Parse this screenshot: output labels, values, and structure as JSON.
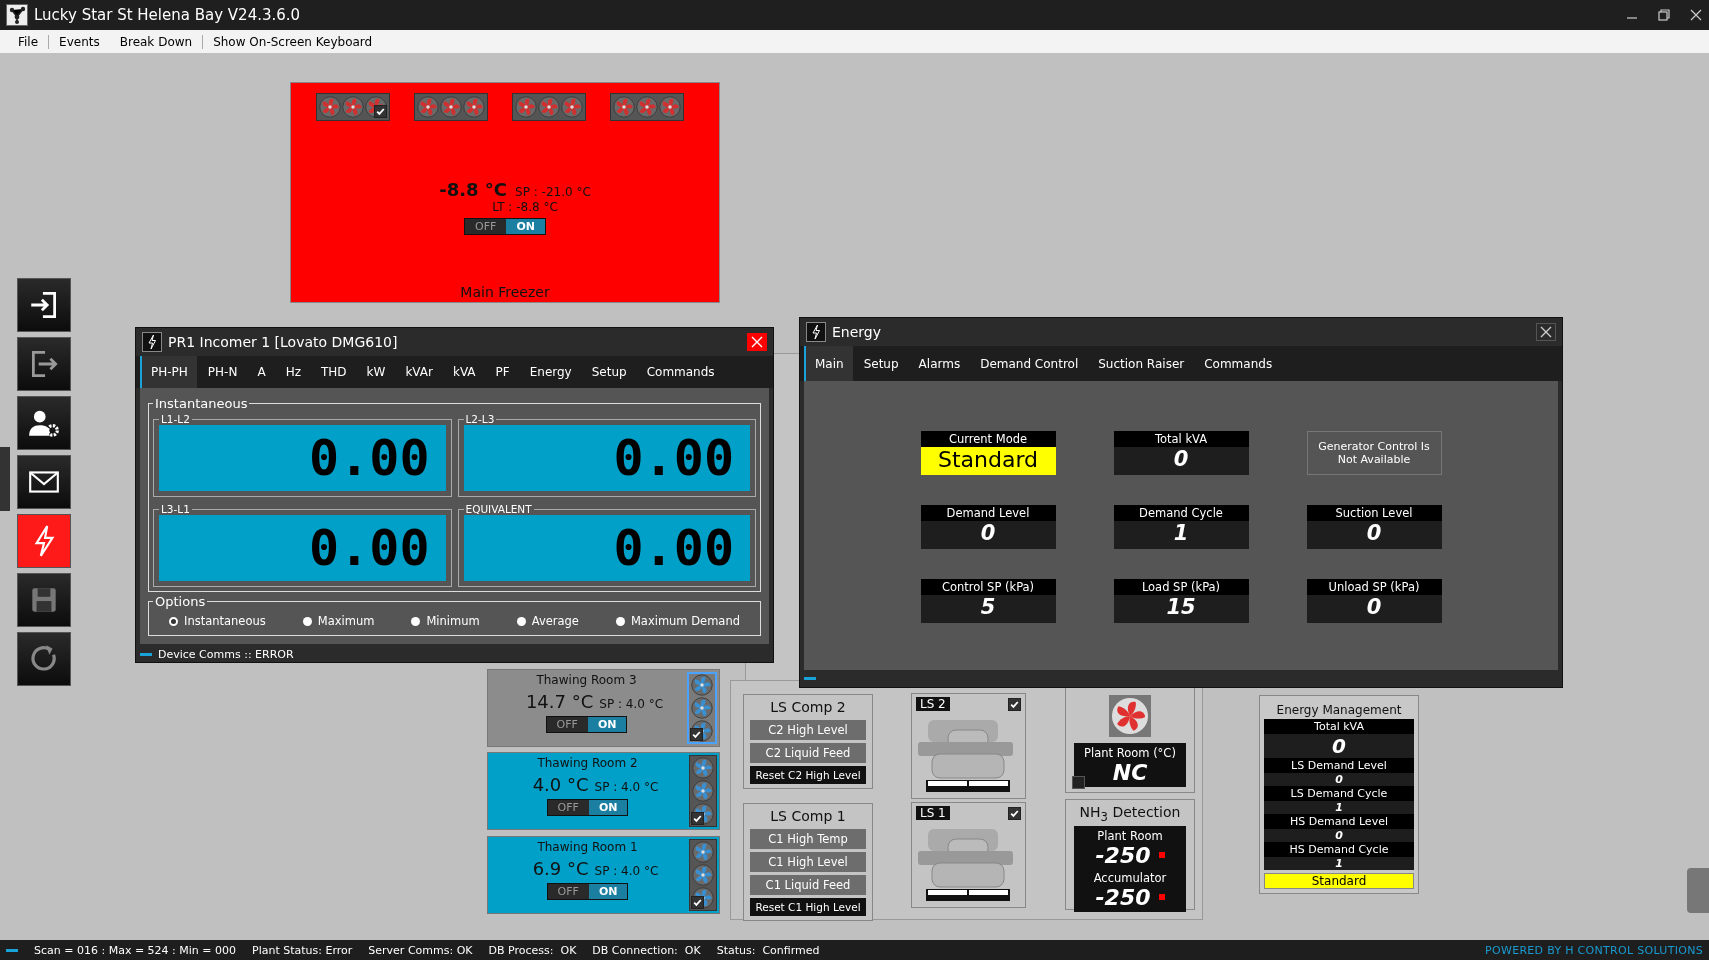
{
  "window": {
    "title": "Lucky Star St Helena Bay V24.3.6.0"
  },
  "menu": [
    {
      "label": "File",
      "separator": true
    },
    {
      "label": "Events",
      "separator": false
    },
    {
      "label": "Break Down",
      "separator": true
    },
    {
      "label": "Show On-Screen Keyboard",
      "separator": false
    }
  ],
  "sidebar": [
    {
      "kind": "login",
      "selected": false
    },
    {
      "kind": "logout",
      "selected": false
    },
    {
      "kind": "users",
      "selected": false
    },
    {
      "kind": "mail",
      "selected": false
    },
    {
      "kind": "energy",
      "selected": true
    },
    {
      "kind": "save",
      "selected": false
    },
    {
      "kind": "refresh",
      "selected": false
    }
  ],
  "rooms": [
    {
      "kind": "freezer",
      "name": "Main Freezer",
      "temp": "-8.8 °C",
      "sp": "SP : -21.0 °C",
      "lt": "LT : -8.8 °C",
      "color": "#ff0000",
      "fan_groups": [
        {
          "checked": true
        },
        {
          "checked": false
        },
        {
          "checked": false
        },
        {
          "checked": false
        }
      ],
      "toggle": [
        {
          "label": "OFF",
          "selected": false
        },
        {
          "label": "ON",
          "selected": true
        }
      ]
    },
    {
      "kind": "thawing",
      "name": "Thawing Room 3",
      "temp": "14.7 °C",
      "sp": "SP : 4.0 °C",
      "color": "#8c8c8c",
      "fans_checked": true,
      "fans_selected": true,
      "toggle": [
        {
          "label": "OFF",
          "selected": false
        },
        {
          "label": "ON",
          "selected": true
        }
      ]
    },
    {
      "kind": "thawing",
      "name": "Thawing Room 2",
      "temp": "4.0 °C",
      "sp": "SP : 4.0 °C",
      "color": "#00a0c8",
      "fans_checked": true,
      "fans_selected": false,
      "toggle": [
        {
          "label": "OFF",
          "selected": false
        },
        {
          "label": "ON",
          "selected": true
        }
      ]
    },
    {
      "kind": "thawing",
      "name": "Thawing Room 1",
      "temp": "6.9 °C",
      "sp": "SP : 4.0 °C",
      "color": "#00a0c8",
      "fans_checked": true,
      "fans_selected": false,
      "toggle": [
        {
          "label": "OFF",
          "selected": false
        },
        {
          "label": "ON",
          "selected": true
        }
      ]
    }
  ],
  "compressor_groups": [
    {
      "title": "LS Comp 2",
      "buttons": [
        {
          "kind": "alarm",
          "label": "C2 High Level"
        },
        {
          "kind": "alarm",
          "label": "C2 Liquid Feed"
        },
        {
          "kind": "reset",
          "label": "Reset C2 High Level"
        }
      ]
    },
    {
      "title": "LS Comp 1",
      "buttons": [
        {
          "kind": "alarm",
          "label": "C1 High Temp"
        },
        {
          "kind": "alarm",
          "label": "C1 High Level"
        },
        {
          "kind": "alarm",
          "label": "C1 Liquid Feed"
        },
        {
          "kind": "reset",
          "label": "Reset C1 High Level"
        }
      ]
    }
  ],
  "compressors": [
    {
      "label": "LS 2",
      "checked": true
    },
    {
      "label": "LS 1",
      "checked": true
    }
  ],
  "extraction_fan": {
    "reading_label": "Plant Room (°C)",
    "reading": "NC",
    "checked": false
  },
  "nh3_detection": {
    "title": "NH$_{3}$ Detection",
    "sensors": [
      {
        "label": "Plant Room",
        "value": "-250"
      },
      {
        "label": "Accumulator",
        "value": "-250"
      }
    ]
  },
  "energy_management": {
    "title": "Energy Management",
    "rows": [
      {
        "label": "Total kVA",
        "value": "0",
        "kind": "large"
      },
      {
        "label": "LS Demand Level",
        "value": "0",
        "kind": "small"
      },
      {
        "label": "LS Demand Cycle",
        "value": "1",
        "kind": "small"
      },
      {
        "label": "HS Demand Level",
        "value": "0",
        "kind": "small"
      },
      {
        "label": "HS Demand Cycle",
        "value": "1",
        "kind": "small"
      }
    ],
    "mode": "Standard"
  },
  "incomer_window": {
    "title": "PR1 Incomer 1 [Lovato DMG610]",
    "tabs": [
      {
        "label": "PH-PH",
        "selected": true
      },
      {
        "label": "PH-N",
        "selected": false
      },
      {
        "label": "A",
        "selected": false
      },
      {
        "label": "Hz",
        "selected": false
      },
      {
        "label": "THD",
        "selected": false
      },
      {
        "label": "kW",
        "selected": false
      },
      {
        "label": "kVAr",
        "selected": false
      },
      {
        "label": "kVA",
        "selected": false
      },
      {
        "label": "PF",
        "selected": false
      },
      {
        "label": "Energy",
        "selected": false
      },
      {
        "label": "Setup",
        "selected": false
      },
      {
        "label": "Commands",
        "selected": false
      }
    ],
    "group_title": "Instantaneous",
    "readings": [
      {
        "label": "L1-L2",
        "value": "0.00"
      },
      {
        "label": "L2-L3",
        "value": "0.00"
      },
      {
        "label": "L3-L1",
        "value": "0.00"
      },
      {
        "label": "EQUIVALENT",
        "value": "0.00"
      }
    ],
    "options_title": "Options",
    "options": [
      {
        "label": "Instantaneous",
        "selected": true
      },
      {
        "label": "Maximum",
        "selected": false
      },
      {
        "label": "Minimum",
        "selected": false
      },
      {
        "label": "Average",
        "selected": false
      },
      {
        "label": "Maximum Demand",
        "selected": false
      }
    ],
    "status": "Device Comms :: ERROR"
  },
  "energy_window": {
    "title": "Energy",
    "tabs": [
      {
        "label": "Main",
        "selected": true
      },
      {
        "label": "Setup",
        "selected": false
      },
      {
        "label": "Alarms",
        "selected": false
      },
      {
        "label": "Demand Control",
        "selected": false
      },
      {
        "label": "Suction Raiser",
        "selected": false
      },
      {
        "label": "Commands",
        "selected": false
      }
    ],
    "tiles": [
      {
        "kind": "mode",
        "label": "Current Mode",
        "value": "Standard"
      },
      {
        "kind": "value",
        "label": "Total kVA",
        "value": "0"
      },
      {
        "kind": "note",
        "text": "Generator Control Is Not Available"
      },
      {
        "kind": "value",
        "label": "Demand Level",
        "value": "0"
      },
      {
        "kind": "value",
        "label": "Demand Cycle",
        "value": "1"
      },
      {
        "kind": "value",
        "label": "Suction Level",
        "value": "0"
      },
      {
        "kind": "value",
        "label": "Control SP (kPa)",
        "value": "5"
      },
      {
        "kind": "value",
        "label": "Load SP (kPa)",
        "value": "15"
      },
      {
        "kind": "value",
        "label": "Unload SP (kPa)",
        "value": "0"
      }
    ]
  },
  "status_bar": {
    "items": [
      "Scan = 016 : Max = 524 : Min = 000",
      "Plant Status: Error",
      "Server Comms: OK",
      "DB Process:  OK",
      "DB Connection:  OK",
      "Status:  Confirmed"
    ],
    "credit": "POWERED BY H CONTROL SOLUTIONS"
  }
}
